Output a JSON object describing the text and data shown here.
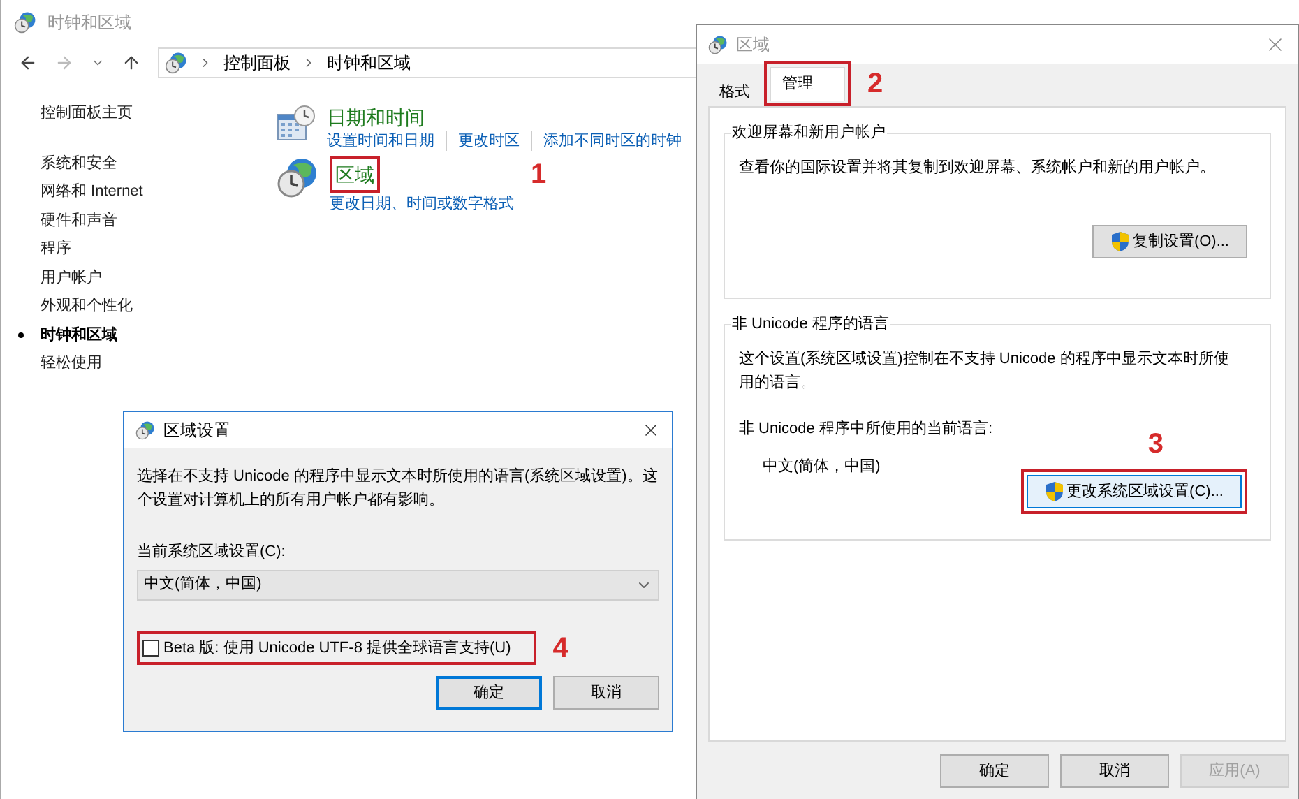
{
  "control_panel": {
    "title": "时钟和区域",
    "breadcrumb": [
      "控制面板",
      "时钟和区域"
    ],
    "sidebar": {
      "home": "控制面板主页",
      "items": [
        {
          "label": "系统和安全",
          "selected": false
        },
        {
          "label": "网络和 Internet",
          "selected": false
        },
        {
          "label": "硬件和声音",
          "selected": false
        },
        {
          "label": "程序",
          "selected": false
        },
        {
          "label": "用户帐户",
          "selected": false
        },
        {
          "label": "外观和个性化",
          "selected": false
        },
        {
          "label": "时钟和区域",
          "selected": true
        },
        {
          "label": "轻松使用",
          "selected": false
        }
      ]
    },
    "categories": [
      {
        "kind": "datetime",
        "title": "日期和时间",
        "links": [
          "设置时间和日期",
          "更改时区",
          "添加不同时区的时钟"
        ]
      },
      {
        "kind": "region",
        "title": "区域",
        "callout": "1",
        "links": [
          "更改日期、时间或数字格式"
        ]
      }
    ]
  },
  "region_dialog": {
    "title": "区域",
    "tabs": [
      {
        "label": "格式",
        "selected": false
      },
      {
        "label": "管理",
        "selected": true,
        "callout": "2"
      }
    ],
    "groups": [
      {
        "title": "欢迎屏幕和新用户帐户",
        "description": "查看你的国际设置并将其复制到欢迎屏幕、系统帐户和新的用户帐户。",
        "button": {
          "label": "复制设置(O)..."
        }
      },
      {
        "title": "非 Unicode 程序的语言",
        "description": "这个设置(系统区域设置)控制在不支持 Unicode 的程序中显示文本时所使用的语言。",
        "current_label": "非 Unicode 程序中所使用的当前语言:",
        "current_value": "中文(简体，中国)",
        "button": {
          "label": "更改系统区域设置(C)...",
          "callout": "3"
        }
      }
    ],
    "buttons": [
      {
        "label": "确定",
        "disabled": false
      },
      {
        "label": "取消",
        "disabled": false
      },
      {
        "label": "应用(A)",
        "disabled": true
      }
    ]
  },
  "locale_dialog": {
    "title": "区域设置",
    "description": "选择在不支持 Unicode 的程序中显示文本时所使用的语言(系统区域设置)。这个设置对计算机上的所有用户帐户都有影响。",
    "field_label": "当前系统区域设置(C):",
    "value": "中文(简体，中国)",
    "checkbox": {
      "label": "Beta 版: 使用 Unicode UTF-8 提供全球语言支持(U)",
      "checked": false,
      "callout": "4"
    },
    "buttons": [
      {
        "label": "确定",
        "selected": true
      },
      {
        "label": "取消",
        "selected": false
      }
    ]
  }
}
